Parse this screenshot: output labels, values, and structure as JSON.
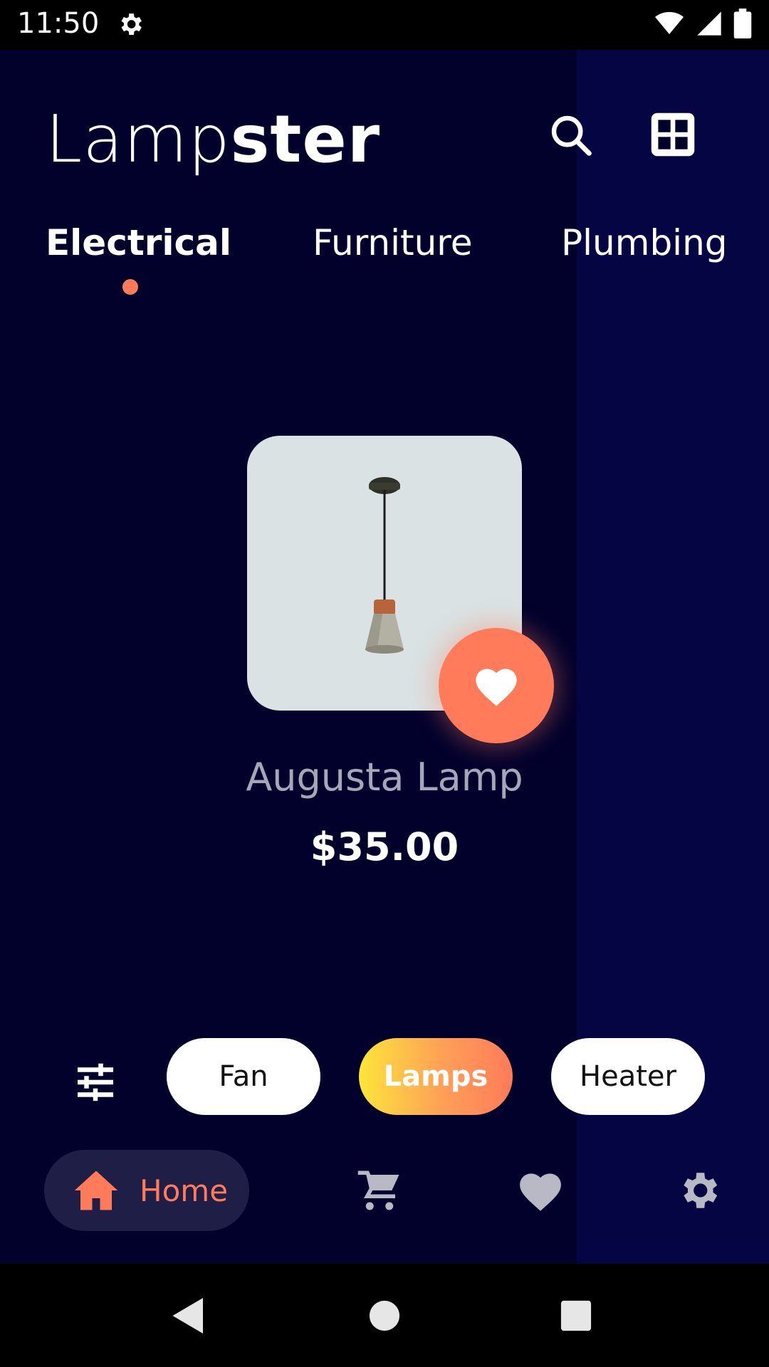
{
  "status_bar": {
    "time": "11:50"
  },
  "app": {
    "logo_light": "Lamp",
    "logo_bold": "ster",
    "tabs": [
      {
        "label": "Electrical",
        "active": true
      },
      {
        "label": "Furniture",
        "active": false
      },
      {
        "label": "Plumbing",
        "active": false
      }
    ],
    "product": {
      "name": "Augusta Lamp",
      "price": "$35.00"
    },
    "chips": [
      {
        "label": "Fan",
        "selected": false
      },
      {
        "label": "Lamps",
        "selected": true
      },
      {
        "label": "Heater",
        "selected": false
      }
    ],
    "bottom_nav": {
      "home_label": "Home",
      "items": [
        "home-icon",
        "cart-icon",
        "heart-icon",
        "gear-icon"
      ]
    }
  },
  "colors": {
    "background": "#02012c",
    "accent": "#ff7b5a",
    "card": "#dae2e3",
    "gradient_start": "#fde53a",
    "gradient_end": "#ff7b5a"
  }
}
